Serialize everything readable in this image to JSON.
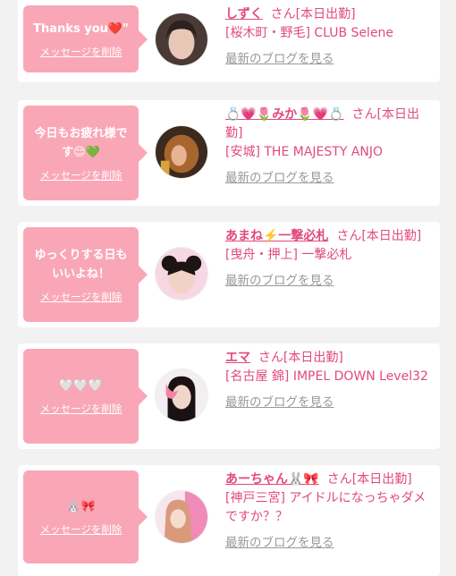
{
  "items": [
    {
      "message": "Thanks you❤️\"",
      "delete_label": "メッセージを削除",
      "name": "しずく",
      "suffix": "さん[本日出勤]",
      "shop": "[桜木町・野毛] CLUB Selene",
      "blog_label": "最新のブログを見る"
    },
    {
      "message": "今日もお疲れ様です😌💚",
      "delete_label": "メッセージを削除",
      "name": "💍💗🌷みか🌷💗💍",
      "suffix": "さん[本日出勤]",
      "shop": "[安城] THE MAJESTY ANJO",
      "blog_label": "最新のブログを見る"
    },
    {
      "message": "ゆっくりする日もいいよね！",
      "delete_label": "メッセージを削除",
      "name": "あまね⚡️一撃必札",
      "suffix": "さん[本日出勤]",
      "shop": "[曳舟・押上] 一撃必札",
      "blog_label": "最新のブログを見る"
    },
    {
      "message": "🤍🤍🤍",
      "delete_label": "メッセージを削除",
      "name": "エマ",
      "suffix": "さん[本日出勤]",
      "shop": "[名古屋 錦] IMPEL DOWN Level32",
      "blog_label": "最新のブログを見る"
    },
    {
      "message": "🐰🎀",
      "delete_label": "メッセージを削除",
      "name": "あーちゃん🐰🎀",
      "suffix": "さん[本日出勤]",
      "shop": "[神戸三宮] アイドルになっちゃダメですか？？",
      "blog_label": "最新のブログを見る"
    }
  ],
  "colors": {
    "bubble": "#f9a7b7",
    "accent": "#e24a7b",
    "muted": "#999999"
  }
}
